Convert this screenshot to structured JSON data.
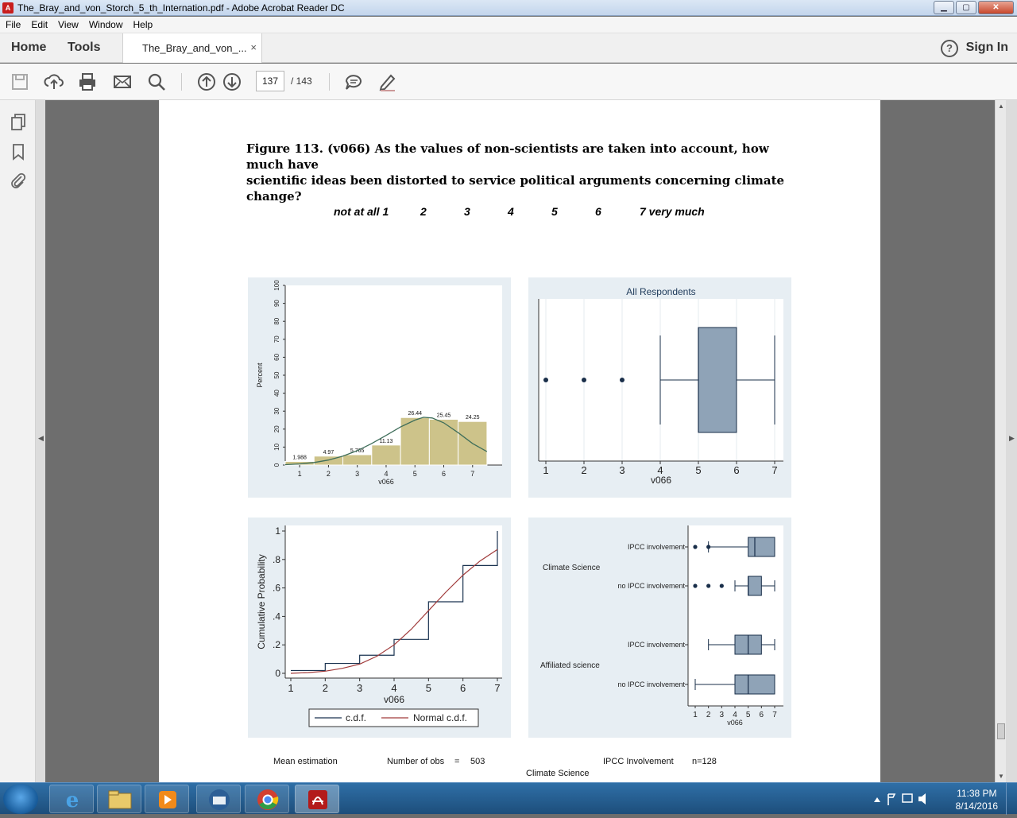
{
  "window": {
    "title": "The_Bray_and_von_Storch_5_th_Internation.pdf - Adobe Acrobat Reader DC",
    "min": "▁",
    "max": "▢",
    "close": "✕"
  },
  "menu": [
    "File",
    "Edit",
    "View",
    "Window",
    "Help"
  ],
  "tabs": {
    "home": "Home",
    "tools": "Tools",
    "doc": "The_Bray_and_von_...",
    "doc_close": "×",
    "signin": "Sign In",
    "help": "?"
  },
  "toolbar": {
    "page_current": "137",
    "page_total": "/ 143"
  },
  "icons": [
    "save-icon",
    "upload-icon",
    "print-icon",
    "mail-icon",
    "search-icon",
    "page-up-icon",
    "page-down-icon",
    "comment-icon",
    "pen-icon",
    "pages-icon",
    "bookmark-icon",
    "attachment-icon"
  ],
  "document": {
    "figure_title_line1": "Figure 113. (v066) As the values of non-scientists are taken into account, how much have",
    "figure_title_line2": "scientific ideas been distorted to service political arguments concerning climate change?",
    "scale_labels": [
      "not at all 1",
      "2",
      "3",
      "4",
      "5",
      "6",
      "7 very much"
    ],
    "footer": {
      "mean": "Mean estimation",
      "nobs_label": "Number of obs",
      "eq": "=",
      "nobs": "503",
      "ipcc": "IPCC Involvement",
      "n": "n=128",
      "climate": "Climate Science"
    }
  },
  "chart_data": [
    {
      "type": "bar",
      "categories": [
        "1",
        "2",
        "3",
        "4",
        "5",
        "6",
        "7"
      ],
      "values": [
        1.988,
        4.97,
        5.765,
        11.13,
        26.44,
        25.45,
        24.25
      ],
      "data_labels": [
        "1.988",
        "4.97",
        "5.765",
        "11.13",
        "26.44",
        "25.45",
        "24.25"
      ],
      "xlabel": "v066",
      "ylabel": "Percent",
      "yticks": [
        "0",
        "10",
        "20",
        "30",
        "40",
        "50",
        "60",
        "70",
        "80",
        "90",
        "100"
      ],
      "ylim": [
        0,
        100
      ],
      "normal_curve": [
        [
          0.5,
          0.2
        ],
        [
          1,
          0.6
        ],
        [
          1.5,
          1.4
        ],
        [
          2,
          2.8
        ],
        [
          2.5,
          5.0
        ],
        [
          3,
          8.0
        ],
        [
          3.5,
          12.0
        ],
        [
          4,
          16.5
        ],
        [
          4.5,
          21.2
        ],
        [
          5,
          25.0
        ],
        [
          5.3,
          26.6
        ],
        [
          5.6,
          26.2
        ],
        [
          6,
          23.5
        ],
        [
          6.5,
          18.0
        ],
        [
          7,
          12.0
        ],
        [
          7.5,
          7.5
        ]
      ],
      "colors": {
        "bar": "#cdc38a",
        "curve": "#3f6e5a"
      }
    },
    {
      "type": "box",
      "title": "All Respondents",
      "xlabel": "v066",
      "xticks": [
        "1",
        "2",
        "3",
        "4",
        "5",
        "6",
        "7"
      ],
      "box": {
        "whisker_low": 4,
        "q1": 5,
        "median": 5,
        "q3": 6,
        "whisker_high": 7
      },
      "outliers": [
        1,
        2,
        3
      ],
      "colors": {
        "box": "#8fa3b7",
        "line": "#1a2f4a"
      }
    },
    {
      "type": "line",
      "xlabel": "v066",
      "ylabel": "Cumulative Probability",
      "xticks": [
        "1",
        "2",
        "3",
        "4",
        "5",
        "6",
        "7"
      ],
      "yticks": [
        "0",
        "​.2",
        "​.4",
        "​.6",
        "​.8",
        "1"
      ],
      "series": [
        {
          "name": "c.d.f.",
          "x": [
            1,
            2,
            3,
            4,
            5,
            6,
            7
          ],
          "values": [
            0.0199,
            0.0696,
            0.1272,
            0.2386,
            0.503,
            0.7575,
            1.0
          ],
          "step": true,
          "color": "#1a3350"
        },
        {
          "name": "Normal c.d.f.",
          "x": [
            1,
            1.5,
            2,
            2.5,
            3,
            3.5,
            4,
            4.5,
            5,
            5.5,
            6,
            6.5,
            7
          ],
          "values": [
            0.0,
            0.005,
            0.015,
            0.035,
            0.065,
            0.12,
            0.2,
            0.31,
            0.44,
            0.57,
            0.69,
            0.79,
            0.87
          ],
          "color": "#a03a3a"
        }
      ]
    },
    {
      "type": "box",
      "xlabel": "v066",
      "xticks": [
        "1",
        "2",
        "3",
        "4",
        "5",
        "6",
        "7"
      ],
      "groups": [
        {
          "group": "Climate Science",
          "rows": [
            {
              "label": "IPCC involvement",
              "whisker_low": 2,
              "q1": 5,
              "median": 5.5,
              "q3": 7,
              "whisker_high": 7,
              "outliers": [
                1,
                2
              ]
            },
            {
              "label": "no IPCC involvement",
              "whisker_low": 4,
              "q1": 5,
              "median": 5,
              "q3": 6,
              "whisker_high": 7,
              "outliers": [
                1,
                2,
                3
              ]
            }
          ]
        },
        {
          "group": "Affiliated science",
          "rows": [
            {
              "label": "IPCC involvement",
              "whisker_low": 2,
              "q1": 4,
              "median": 5,
              "q3": 6,
              "whisker_high": 7,
              "outliers": []
            },
            {
              "label": "no IPCC involvement",
              "whisker_low": 1,
              "q1": 4,
              "median": 5,
              "q3": 7,
              "whisker_high": 7,
              "outliers": []
            }
          ]
        }
      ],
      "colors": {
        "box": "#8fa3b7",
        "line": "#1a2f4a"
      }
    }
  ],
  "taskbar": {
    "time": "11:38 PM",
    "date": "8/14/2016"
  },
  "taskbar_apps": [
    "start-button",
    "ie-icon",
    "explorer-icon",
    "media-player-icon",
    "thunderbird-icon",
    "chrome-icon",
    "acrobat-icon"
  ]
}
